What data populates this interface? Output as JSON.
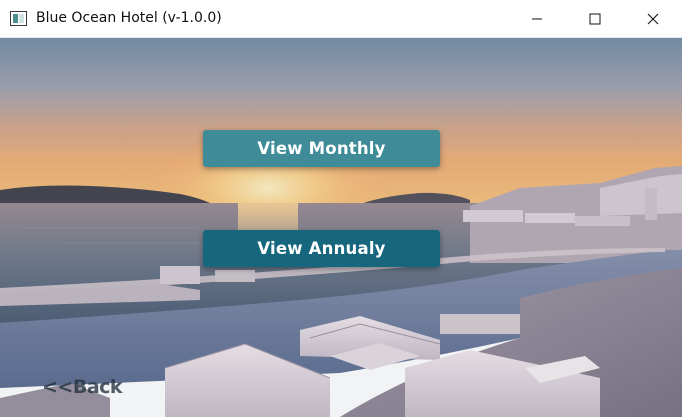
{
  "window": {
    "title": "Blue Ocean Hotel (v-1.0.0)",
    "controls": [
      "minimize",
      "maximize",
      "close"
    ]
  },
  "main": {
    "view_monthly_label": "View Monthly",
    "view_annual_label": "View Annualy",
    "back_label": "<<Back"
  },
  "colors": {
    "monthly_button": "#3f8c98",
    "annual_button": "#16677e",
    "button_text": "#ffffff"
  },
  "icons": {
    "app": "app-window-icon",
    "minimize": "minimize-icon",
    "maximize": "maximize-icon",
    "close": "close-icon"
  }
}
